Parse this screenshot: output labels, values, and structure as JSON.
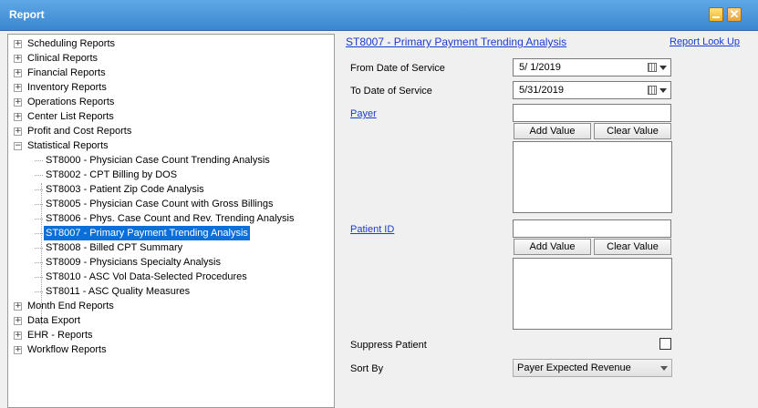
{
  "window": {
    "title": "Report",
    "close_glyph": "✕"
  },
  "tree": {
    "items": [
      {
        "label": "Scheduling Reports",
        "level": 0,
        "expander": "+"
      },
      {
        "label": "Clinical Reports",
        "level": 0,
        "expander": "+"
      },
      {
        "label": "Financial Reports",
        "level": 0,
        "expander": "+"
      },
      {
        "label": "Inventory Reports",
        "level": 0,
        "expander": "+"
      },
      {
        "label": "Operations Reports",
        "level": 0,
        "expander": "+"
      },
      {
        "label": "Center List Reports",
        "level": 0,
        "expander": "+"
      },
      {
        "label": "Profit and Cost Reports",
        "level": 0,
        "expander": "+"
      },
      {
        "label": "Statistical Reports",
        "level": 0,
        "expander": "−"
      },
      {
        "label": "ST8000 - Physician Case Count Trending Analysis",
        "level": 1
      },
      {
        "label": "ST8002 - CPT Billing by DOS",
        "level": 1
      },
      {
        "label": "ST8003 - Patient Zip Code Analysis",
        "level": 1
      },
      {
        "label": "ST8005 - Physician Case Count with Gross Billings",
        "level": 1
      },
      {
        "label": "ST8006 - Phys. Case Count and Rev. Trending Analysis",
        "level": 1
      },
      {
        "label": "ST8007 - Primary Payment Trending Analysis",
        "level": 1,
        "selected": true
      },
      {
        "label": "ST8008 - Billed CPT Summary",
        "level": 1
      },
      {
        "label": "ST8009 - Physicians Specialty Analysis",
        "level": 1
      },
      {
        "label": "ST8010 - ASC Vol Data-Selected Procedures",
        "level": 1
      },
      {
        "label": "ST8011 - ASC Quality Measures",
        "level": 1
      },
      {
        "label": "Month End Reports",
        "level": 0,
        "expander": "+"
      },
      {
        "label": "Data Export",
        "level": 0,
        "expander": "+"
      },
      {
        "label": "EHR - Reports",
        "level": 0,
        "expander": "+"
      },
      {
        "label": "Workflow Reports",
        "level": 0,
        "expander": "+"
      }
    ]
  },
  "report": {
    "title": "ST8007 - Primary Payment Trending Analysis",
    "lookup_link": "Report Look Up",
    "from_label": "From Date of Service",
    "from_value": "5/  1/2019",
    "to_label": "To Date of Service",
    "to_value": "5/31/2019",
    "payer_label": "Payer",
    "payer_value": "",
    "payer_add": "Add Value",
    "payer_clear": "Clear Value",
    "patient_label": "Patient ID",
    "patient_value": "",
    "patient_add": "Add Value",
    "patient_clear": "Clear Value",
    "suppress_label": "Suppress Patient",
    "suppress_checked": false,
    "sort_label": "Sort By",
    "sort_value": "Payer Expected Revenue"
  },
  "icons": {
    "calendar": "calendar-icon",
    "dropdown": "chevron-down-icon",
    "minimize": "minimize-icon",
    "close": "close-icon"
  },
  "colors": {
    "titlebar": "#3a86d0",
    "selection": "#0a6fd8",
    "link": "#1b3ccd"
  }
}
